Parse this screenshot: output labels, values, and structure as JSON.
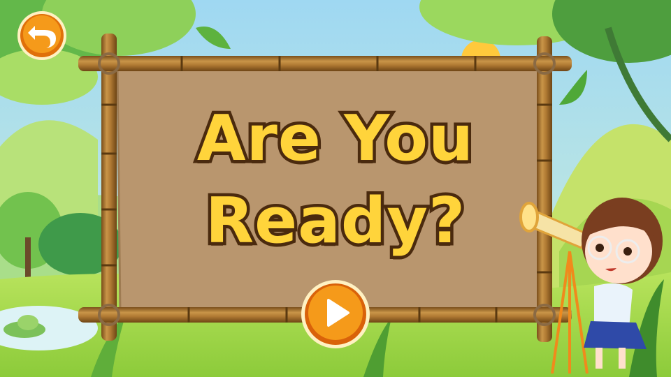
{
  "screen": {
    "title_line1": "Are You",
    "title_line2": "Ready?"
  },
  "controls": {
    "back_icon": "undo-arrow-icon",
    "play_icon": "play-triangle-icon"
  },
  "colors": {
    "title_fill": "#FFD43B",
    "title_outline": "#4A2A0E",
    "button_orange": "#F08A12",
    "board_paper": "#B9966E",
    "bamboo": "#A5722D",
    "grass": "#9BD53E"
  }
}
